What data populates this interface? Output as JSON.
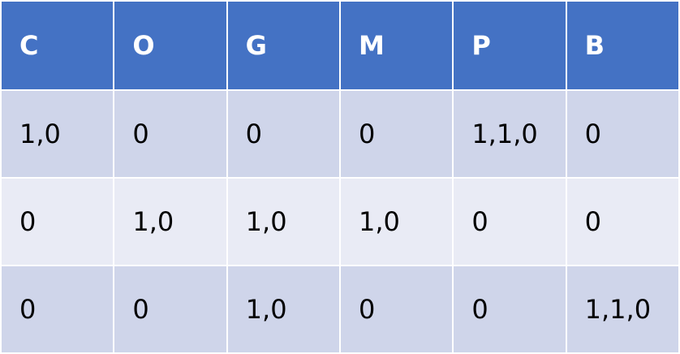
{
  "colors": {
    "header_bg": "#4472c4",
    "header_text": "#ffffff",
    "row_odd_bg": "#cfd5ea",
    "row_even_bg": "#e9ebf5",
    "cell_text": "#000000"
  },
  "table": {
    "headers": [
      "C",
      "O",
      "G",
      "M",
      "P",
      "B"
    ],
    "rows": [
      [
        "1,0",
        "0",
        "0",
        "0",
        "1,1,0",
        "0"
      ],
      [
        "0",
        "1,0",
        "1,0",
        "1,0",
        "0",
        "0"
      ],
      [
        "0",
        "0",
        "1,0",
        "0",
        "0",
        "1,1,0"
      ]
    ]
  }
}
